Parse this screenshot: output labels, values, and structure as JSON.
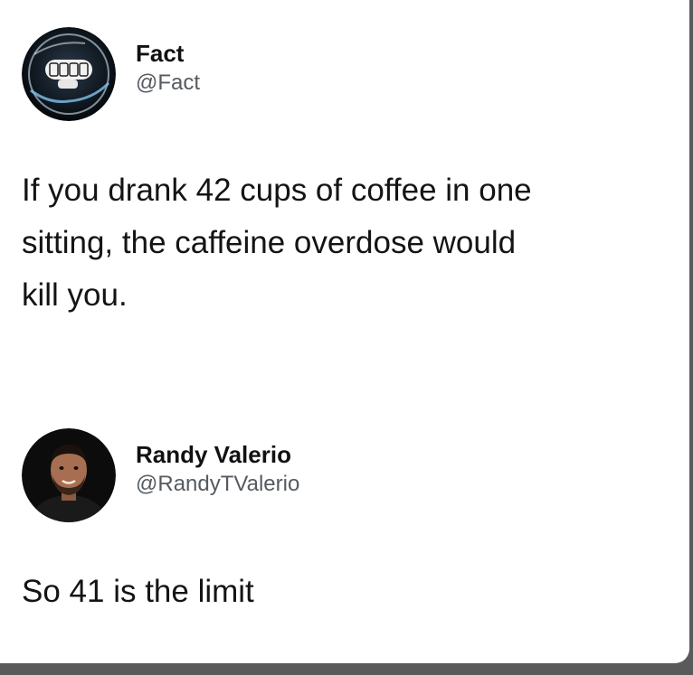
{
  "tweet": {
    "author": {
      "display_name": "Fact",
      "handle": "@Fact",
      "avatar_icon": "fact-logo-avatar"
    },
    "text": "If you drank 42 cups of coffee in one\nsitting, the caffeine overdose would\nkill you."
  },
  "reply": {
    "author": {
      "display_name": "Randy Valerio",
      "handle": "@RandyTValerio",
      "avatar_icon": "user-photo-avatar"
    },
    "text": "So 41 is the limit"
  },
  "colors": {
    "background": "#ffffff",
    "text": "#141414",
    "handle": "#555b60",
    "frame": "#5a5a5a"
  }
}
